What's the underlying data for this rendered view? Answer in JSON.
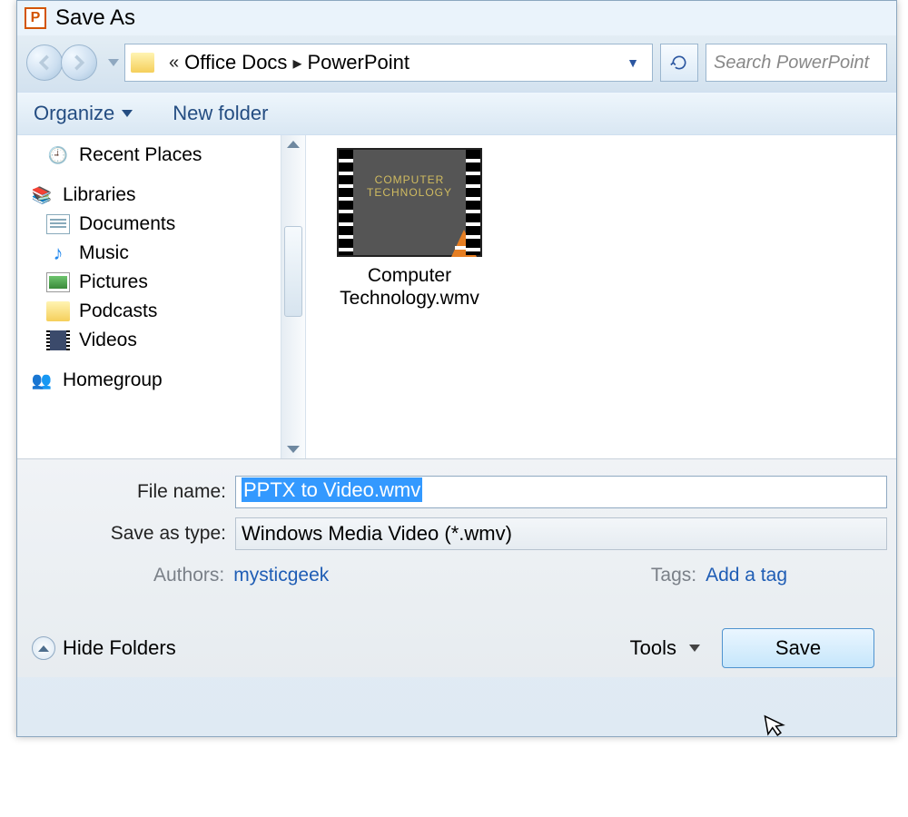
{
  "window": {
    "title": "Save As"
  },
  "nav": {
    "breadcrumb_prefix": "«",
    "segments": [
      "Office Docs",
      "PowerPoint"
    ],
    "search_placeholder": "Search PowerPoint"
  },
  "toolbar": {
    "organize_label": "Organize",
    "newfolder_label": "New folder"
  },
  "sidebar": {
    "recent_label": "Recent Places",
    "libraries_label": "Libraries",
    "items": [
      {
        "label": "Documents"
      },
      {
        "label": "Music"
      },
      {
        "label": "Pictures"
      },
      {
        "label": "Podcasts"
      },
      {
        "label": "Videos"
      }
    ],
    "homegroup_label": "Homegroup"
  },
  "files": [
    {
      "thumb_overlay": "COMPUTER TECHNOLOGY",
      "name_line1": "Computer",
      "name_line2": "Technology.wmv"
    }
  ],
  "form": {
    "filename_label": "File name:",
    "filename_value": "PPTX to Video.wmv",
    "savetype_label": "Save as type:",
    "savetype_value": "Windows Media Video (*.wmv)",
    "authors_label": "Authors:",
    "authors_value": "mysticgeek",
    "tags_label": "Tags:",
    "tags_value": "Add a tag"
  },
  "footer": {
    "hide_folders_label": "Hide Folders",
    "tools_label": "Tools",
    "save_label": "Save"
  }
}
